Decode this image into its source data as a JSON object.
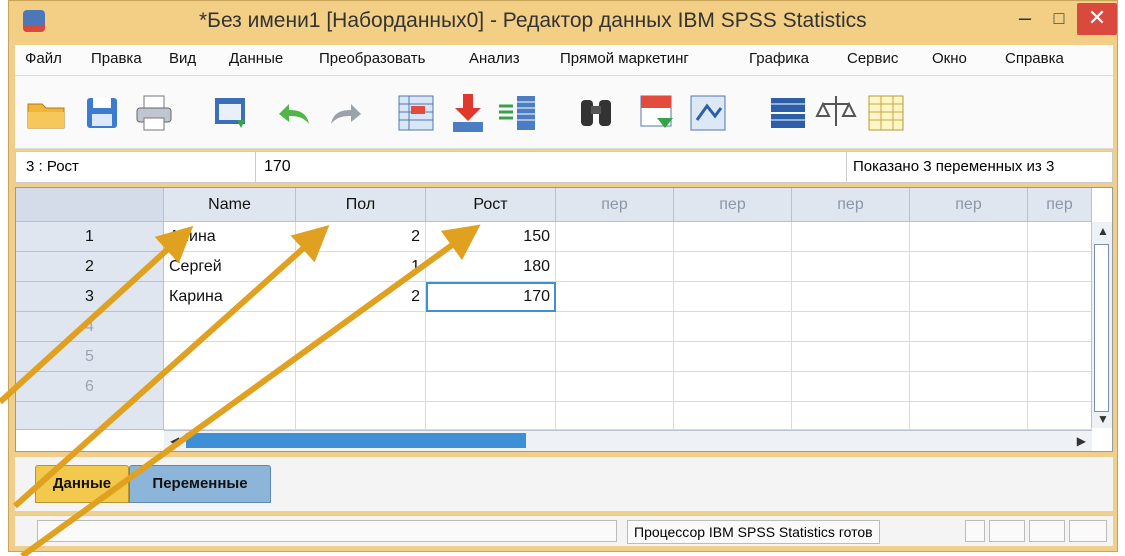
{
  "window": {
    "title": "*Без имени1 [Наборданных0] - Редактор данных IBM SPSS Statistics",
    "minimize": "–",
    "maximize": "□",
    "close": "✕"
  },
  "menu": [
    "Файл",
    "Правка",
    "Вид",
    "Данные",
    "Преобразовать",
    "Анализ",
    "Прямой маркетинг",
    "Графика",
    "Сервис",
    "Окно",
    "Справка"
  ],
  "toolbar": {
    "icons": [
      "open-folder-icon",
      "save-icon",
      "print-icon",
      "dialog-recall-icon",
      "undo-icon",
      "redo-icon",
      "goto-case-icon",
      "goto-variable-icon",
      "variables-icon",
      "find-icon",
      "insert-cases-icon",
      "insert-variable-icon",
      "split-file-icon",
      "weight-cases-icon",
      "select-cases-icon"
    ]
  },
  "cell_ref": {
    "name": "3 : Рост",
    "value": "170",
    "var_count": "Показано 3 переменных из 3"
  },
  "grid": {
    "columns": [
      "Name",
      "Пол",
      "Рост",
      "пер",
      "пер",
      "пер",
      "пер",
      "пер"
    ],
    "rows": [
      {
        "num": "1",
        "name": "Алина",
        "sex": "2",
        "height": "150"
      },
      {
        "num": "2",
        "name": "Сергей",
        "sex": "1",
        "height": "180"
      },
      {
        "num": "3",
        "name": "Карина",
        "sex": "2",
        "height": "170"
      },
      {
        "num": "4",
        "name": "",
        "sex": "",
        "height": ""
      },
      {
        "num": "5",
        "name": "",
        "sex": "",
        "height": ""
      },
      {
        "num": "6",
        "name": "",
        "sex": "",
        "height": ""
      }
    ]
  },
  "tabs": {
    "data": "Данные",
    "variables": "Переменные"
  },
  "status": {
    "processor": "Процессор IBM SPSS Statistics  готов"
  },
  "colors": {
    "arrow": "#e0a020",
    "accent": "#3e8fd6",
    "active_tab": "#f2c94c"
  }
}
